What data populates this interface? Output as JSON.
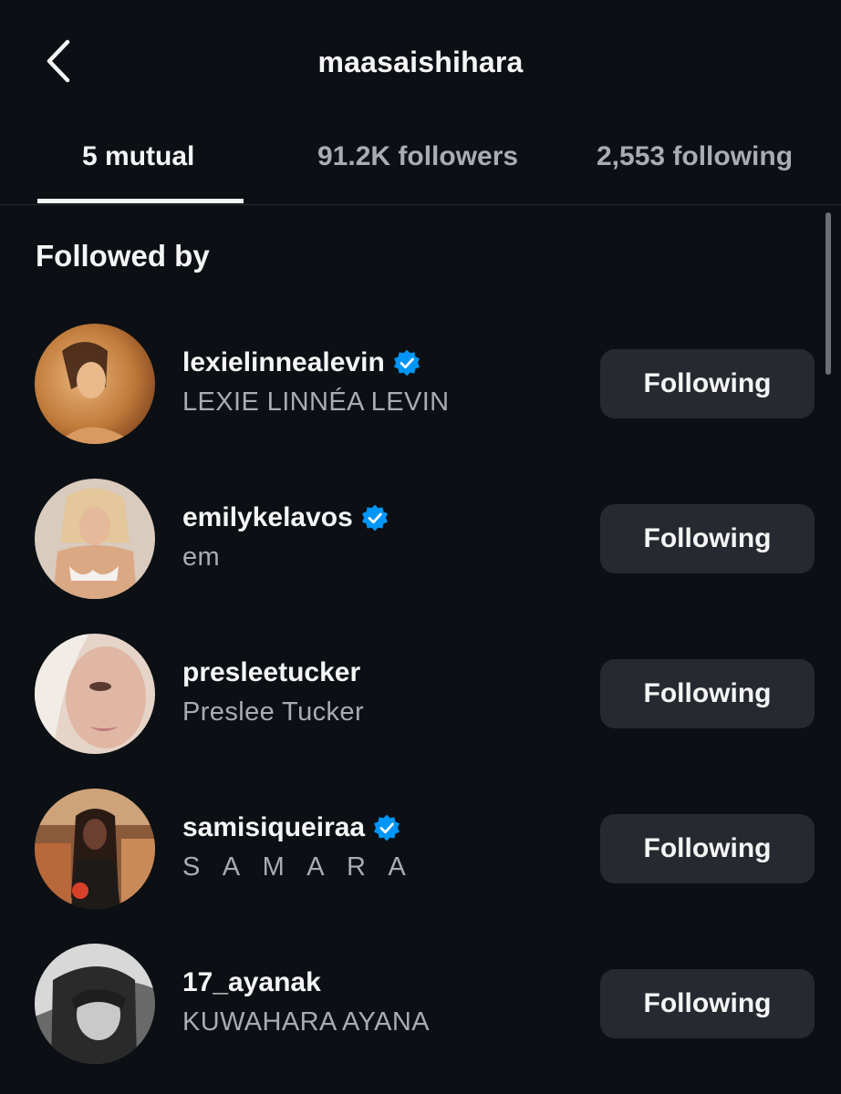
{
  "header": {
    "title": "maasaishihara",
    "back_icon": "chevron-left-icon"
  },
  "tabs": [
    {
      "label": "5 mutual",
      "active": true
    },
    {
      "label": "91.2K followers",
      "active": false
    },
    {
      "label": "2,553 following",
      "active": false
    }
  ],
  "section": {
    "title": "Followed by"
  },
  "accounts": [
    {
      "username": "lexielinnealevin",
      "full_name": "LEXIE LINNÉA LEVIN",
      "verified": true,
      "button_label": "Following"
    },
    {
      "username": "emilykelavos",
      "full_name": "em",
      "verified": true,
      "button_label": "Following"
    },
    {
      "username": "presleetucker",
      "full_name": "Preslee Tucker",
      "verified": false,
      "button_label": "Following"
    },
    {
      "username": "samisiqueiraa",
      "full_name": "S A M A R A",
      "verified": true,
      "button_label": "Following"
    },
    {
      "username": "17_ayanak",
      "full_name": "KUWAHARA AYANA",
      "verified": false,
      "button_label": "Following"
    }
  ],
  "colors": {
    "background": "#0c1014",
    "text_primary": "#f5f5f5",
    "text_secondary": "#a8acb3",
    "button_bg": "#262a30",
    "verified_blue": "#0095f6"
  }
}
